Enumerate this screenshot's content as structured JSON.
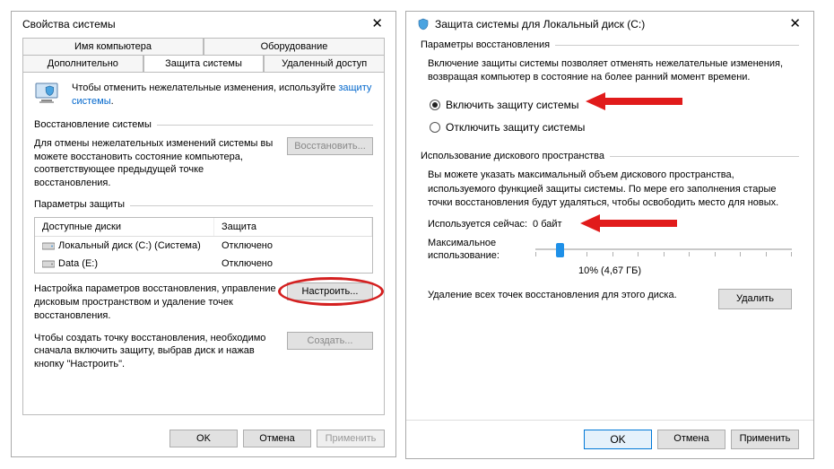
{
  "left": {
    "title": "Свойства системы",
    "tabs": {
      "row1": [
        "Имя компьютера",
        "Оборудование"
      ],
      "row2": [
        "Дополнительно",
        "Защита системы",
        "Удаленный доступ"
      ],
      "active": "Защита системы"
    },
    "info_text_a": "Чтобы отменить нежелательные изменения, используйте ",
    "info_link": "защиту системы",
    "info_text_b": ".",
    "restore": {
      "heading": "Восстановление системы",
      "desc": "Для отмены нежелательных изменений системы вы можете восстановить состояние компьютера, соответствующее предыдущей точке восстановления.",
      "button": "Восстановить..."
    },
    "protection": {
      "heading": "Параметры защиты",
      "col_drive": "Доступные диски",
      "col_prot": "Защита",
      "rows": [
        {
          "name": "Локальный диск (C:) (Система)",
          "status": "Отключено"
        },
        {
          "name": "Data (E:)",
          "status": "Отключено"
        }
      ],
      "config_desc": "Настройка параметров восстановления, управление дисковым пространством и удаление точек восстановления.",
      "config_btn": "Настроить...",
      "create_desc": "Чтобы создать точку восстановления, необходимо сначала включить защиту, выбрав диск и нажав кнопку \"Настроить\".",
      "create_btn": "Создать..."
    },
    "buttons": {
      "ok": "OK",
      "cancel": "Отмена",
      "apply": "Применить"
    }
  },
  "right": {
    "title": "Защита системы для Локальный диск (C:)",
    "params": {
      "heading": "Параметры восстановления",
      "desc": "Включение защиты системы позволяет отменять нежелательные изменения, возвращая компьютер в состояние на более ранний момент времени.",
      "radio_on": "Включить защиту системы",
      "radio_off": "Отключить защиту системы"
    },
    "usage": {
      "heading": "Использование дискового пространства",
      "desc": "Вы можете указать максимальный объем дискового пространства, используемого функцией защиты системы. По мере его заполнения старые точки восстановления будут удаляться, чтобы освободить место для новых.",
      "now_label": "Используется сейчас:",
      "now_value": "0 байт",
      "max_label": "Максимальное использование:",
      "slider_value": "10% (4,67 ГБ)",
      "delete_desc": "Удаление всех точек восстановления для этого диска.",
      "delete_btn": "Удалить"
    },
    "buttons": {
      "ok": "OK",
      "cancel": "Отмена",
      "apply": "Применить"
    }
  }
}
